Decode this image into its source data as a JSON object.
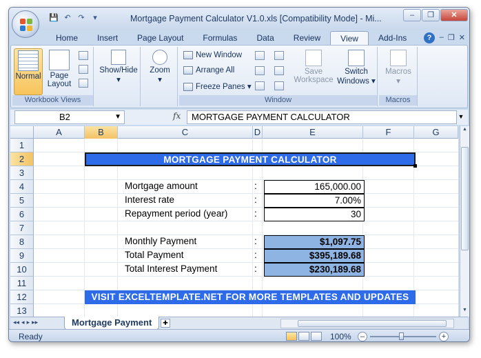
{
  "window": {
    "title": "Mortgage Payment Calculator V1.0.xls  [Compatibility Mode] - Mi...",
    "minimize": "–",
    "restore": "❐",
    "close": "✕"
  },
  "qat": {
    "save": "💾",
    "undo": "↶",
    "redo": "↷",
    "customize": "▾"
  },
  "ribbon_tabs": [
    "Home",
    "Insert",
    "Page Layout",
    "Formulas",
    "Data",
    "Review",
    "View",
    "Add-Ins"
  ],
  "active_tab": "View",
  "help": "?",
  "ribbon": {
    "workbook_views": {
      "label": "Workbook Views",
      "normal": "Normal",
      "page_layout": [
        "Page",
        "Layout"
      ]
    },
    "show_hide": {
      "label": "Show/Hide",
      "arrow": "▾"
    },
    "zoom": {
      "label": "Zoom",
      "arrow": "▾"
    },
    "window": {
      "label": "Window",
      "new_window": "New Window",
      "arrange_all": "Arrange All",
      "freeze_panes": "Freeze Panes",
      "freeze_arrow": "▾",
      "save_workspace": [
        "Save",
        "Workspace"
      ],
      "switch_windows": [
        "Switch",
        "Windows"
      ],
      "switch_arrow": "▾"
    },
    "macros": {
      "label": "Macros",
      "button": "Macros",
      "arrow": "▾"
    }
  },
  "formula_bar": {
    "name_box": "B2",
    "fx": "fx",
    "content": "MORTGAGE PAYMENT CALCULATOR"
  },
  "columns": [
    "A",
    "B",
    "C",
    "D",
    "E",
    "F",
    "G"
  ],
  "selected_column": "B",
  "rows": [
    "1",
    "2",
    "3",
    "4",
    "5",
    "6",
    "7",
    "8",
    "9",
    "10",
    "11",
    "12",
    "13"
  ],
  "selected_row": "2",
  "sheet": {
    "title": "MORTGAGE PAYMENT CALCULATOR",
    "inputs": [
      {
        "label": "Mortgage amount",
        "colon": ":",
        "value": "165,000.00"
      },
      {
        "label": "Interest rate",
        "colon": ":",
        "value": "7.00%"
      },
      {
        "label": "Repayment period (year)",
        "colon": ":",
        "value": "30"
      }
    ],
    "results": [
      {
        "label": "Monthly Payment",
        "colon": ":",
        "value": "$1,097.75"
      },
      {
        "label": "Total Payment",
        "colon": ":",
        "value": "$395,189.68"
      },
      {
        "label": "Total Interest Payment",
        "colon": ":",
        "value": "$230,189.68"
      }
    ],
    "footer": "VISIT EXCELTEMPLATE.NET FOR MORE TEMPLATES AND UPDATES"
  },
  "sheet_tabs": {
    "nav": [
      "◂◂",
      "◂",
      "▸",
      "▸▸"
    ],
    "active": "Mortgage Payment"
  },
  "status": {
    "ready": "Ready",
    "zoom": "100%",
    "zoom_level_fraction": 0.5,
    "minus": "–",
    "plus": "+"
  },
  "colors": {
    "banner": "#2d6be8",
    "result_fill": "#8db4e2",
    "selection": "#f7c35a"
  }
}
